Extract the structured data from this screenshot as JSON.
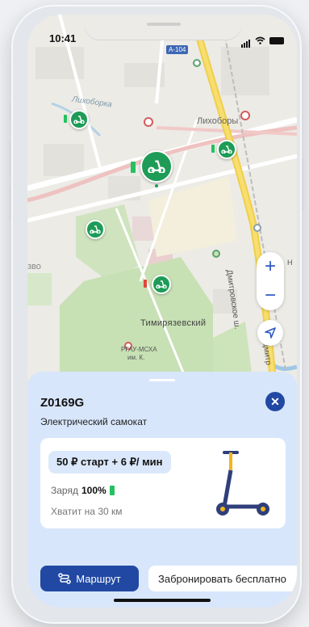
{
  "status_bar": {
    "time": "10:41"
  },
  "map": {
    "road_badge": "A-104",
    "labels": {
      "street_likhoborka": "Лихоборка",
      "district_likhobory": "Лихоборы",
      "left_edge": "зво",
      "timiryazevsky": "Тимирязевский",
      "university_line1": "РГАУ-МСХА",
      "university_line2": "им. К.",
      "dmitrovskoe": "Дмитровское ш.",
      "dmitr_short": "Дмитр",
      "right_edge": "Н"
    },
    "controls": {
      "zoom_in": "+",
      "zoom_out": "−"
    }
  },
  "sheet": {
    "scooter_id": "Z0169G",
    "scooter_type": "Электрический самокат",
    "close_symbol": "✕",
    "price": "50 ₽ старт + 6 ₽/ мин",
    "charge_label": "Заряд",
    "charge_value": "100%",
    "range_text": "Хватит на 30 км",
    "route_button": "Маршрут",
    "book_button": "Забронировать бесплатно"
  },
  "colors": {
    "accent": "#2148a3",
    "pin_green": "#1e9c57",
    "sheet_bg": "#d8e6fb",
    "road_yellow": "#f0cf4a"
  }
}
